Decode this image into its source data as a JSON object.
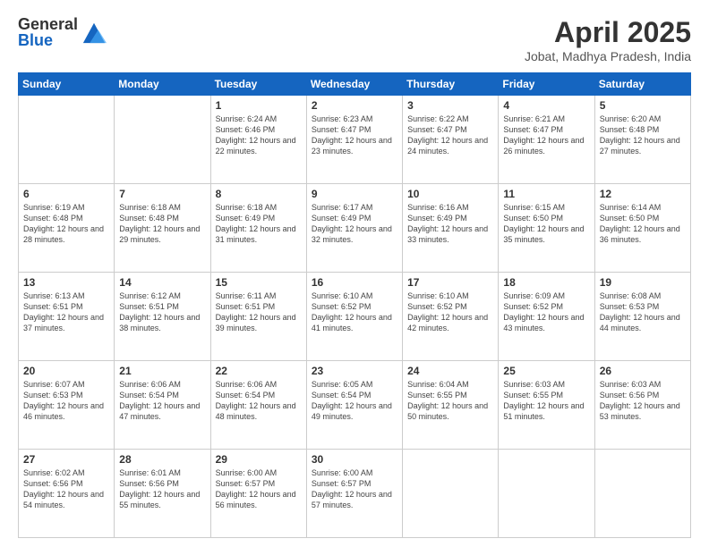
{
  "logo": {
    "general": "General",
    "blue": "Blue"
  },
  "title": "April 2025",
  "subtitle": "Jobat, Madhya Pradesh, India",
  "days_header": [
    "Sunday",
    "Monday",
    "Tuesday",
    "Wednesday",
    "Thursday",
    "Friday",
    "Saturday"
  ],
  "weeks": [
    [
      {
        "day": "",
        "info": ""
      },
      {
        "day": "",
        "info": ""
      },
      {
        "day": "1",
        "info": "Sunrise: 6:24 AM\nSunset: 6:46 PM\nDaylight: 12 hours and 22 minutes."
      },
      {
        "day": "2",
        "info": "Sunrise: 6:23 AM\nSunset: 6:47 PM\nDaylight: 12 hours and 23 minutes."
      },
      {
        "day": "3",
        "info": "Sunrise: 6:22 AM\nSunset: 6:47 PM\nDaylight: 12 hours and 24 minutes."
      },
      {
        "day": "4",
        "info": "Sunrise: 6:21 AM\nSunset: 6:47 PM\nDaylight: 12 hours and 26 minutes."
      },
      {
        "day": "5",
        "info": "Sunrise: 6:20 AM\nSunset: 6:48 PM\nDaylight: 12 hours and 27 minutes."
      }
    ],
    [
      {
        "day": "6",
        "info": "Sunrise: 6:19 AM\nSunset: 6:48 PM\nDaylight: 12 hours and 28 minutes."
      },
      {
        "day": "7",
        "info": "Sunrise: 6:18 AM\nSunset: 6:48 PM\nDaylight: 12 hours and 29 minutes."
      },
      {
        "day": "8",
        "info": "Sunrise: 6:18 AM\nSunset: 6:49 PM\nDaylight: 12 hours and 31 minutes."
      },
      {
        "day": "9",
        "info": "Sunrise: 6:17 AM\nSunset: 6:49 PM\nDaylight: 12 hours and 32 minutes."
      },
      {
        "day": "10",
        "info": "Sunrise: 6:16 AM\nSunset: 6:49 PM\nDaylight: 12 hours and 33 minutes."
      },
      {
        "day": "11",
        "info": "Sunrise: 6:15 AM\nSunset: 6:50 PM\nDaylight: 12 hours and 35 minutes."
      },
      {
        "day": "12",
        "info": "Sunrise: 6:14 AM\nSunset: 6:50 PM\nDaylight: 12 hours and 36 minutes."
      }
    ],
    [
      {
        "day": "13",
        "info": "Sunrise: 6:13 AM\nSunset: 6:51 PM\nDaylight: 12 hours and 37 minutes."
      },
      {
        "day": "14",
        "info": "Sunrise: 6:12 AM\nSunset: 6:51 PM\nDaylight: 12 hours and 38 minutes."
      },
      {
        "day": "15",
        "info": "Sunrise: 6:11 AM\nSunset: 6:51 PM\nDaylight: 12 hours and 39 minutes."
      },
      {
        "day": "16",
        "info": "Sunrise: 6:10 AM\nSunset: 6:52 PM\nDaylight: 12 hours and 41 minutes."
      },
      {
        "day": "17",
        "info": "Sunrise: 6:10 AM\nSunset: 6:52 PM\nDaylight: 12 hours and 42 minutes."
      },
      {
        "day": "18",
        "info": "Sunrise: 6:09 AM\nSunset: 6:52 PM\nDaylight: 12 hours and 43 minutes."
      },
      {
        "day": "19",
        "info": "Sunrise: 6:08 AM\nSunset: 6:53 PM\nDaylight: 12 hours and 44 minutes."
      }
    ],
    [
      {
        "day": "20",
        "info": "Sunrise: 6:07 AM\nSunset: 6:53 PM\nDaylight: 12 hours and 46 minutes."
      },
      {
        "day": "21",
        "info": "Sunrise: 6:06 AM\nSunset: 6:54 PM\nDaylight: 12 hours and 47 minutes."
      },
      {
        "day": "22",
        "info": "Sunrise: 6:06 AM\nSunset: 6:54 PM\nDaylight: 12 hours and 48 minutes."
      },
      {
        "day": "23",
        "info": "Sunrise: 6:05 AM\nSunset: 6:54 PM\nDaylight: 12 hours and 49 minutes."
      },
      {
        "day": "24",
        "info": "Sunrise: 6:04 AM\nSunset: 6:55 PM\nDaylight: 12 hours and 50 minutes."
      },
      {
        "day": "25",
        "info": "Sunrise: 6:03 AM\nSunset: 6:55 PM\nDaylight: 12 hours and 51 minutes."
      },
      {
        "day": "26",
        "info": "Sunrise: 6:03 AM\nSunset: 6:56 PM\nDaylight: 12 hours and 53 minutes."
      }
    ],
    [
      {
        "day": "27",
        "info": "Sunrise: 6:02 AM\nSunset: 6:56 PM\nDaylight: 12 hours and 54 minutes."
      },
      {
        "day": "28",
        "info": "Sunrise: 6:01 AM\nSunset: 6:56 PM\nDaylight: 12 hours and 55 minutes."
      },
      {
        "day": "29",
        "info": "Sunrise: 6:00 AM\nSunset: 6:57 PM\nDaylight: 12 hours and 56 minutes."
      },
      {
        "day": "30",
        "info": "Sunrise: 6:00 AM\nSunset: 6:57 PM\nDaylight: 12 hours and 57 minutes."
      },
      {
        "day": "",
        "info": ""
      },
      {
        "day": "",
        "info": ""
      },
      {
        "day": "",
        "info": ""
      }
    ]
  ]
}
